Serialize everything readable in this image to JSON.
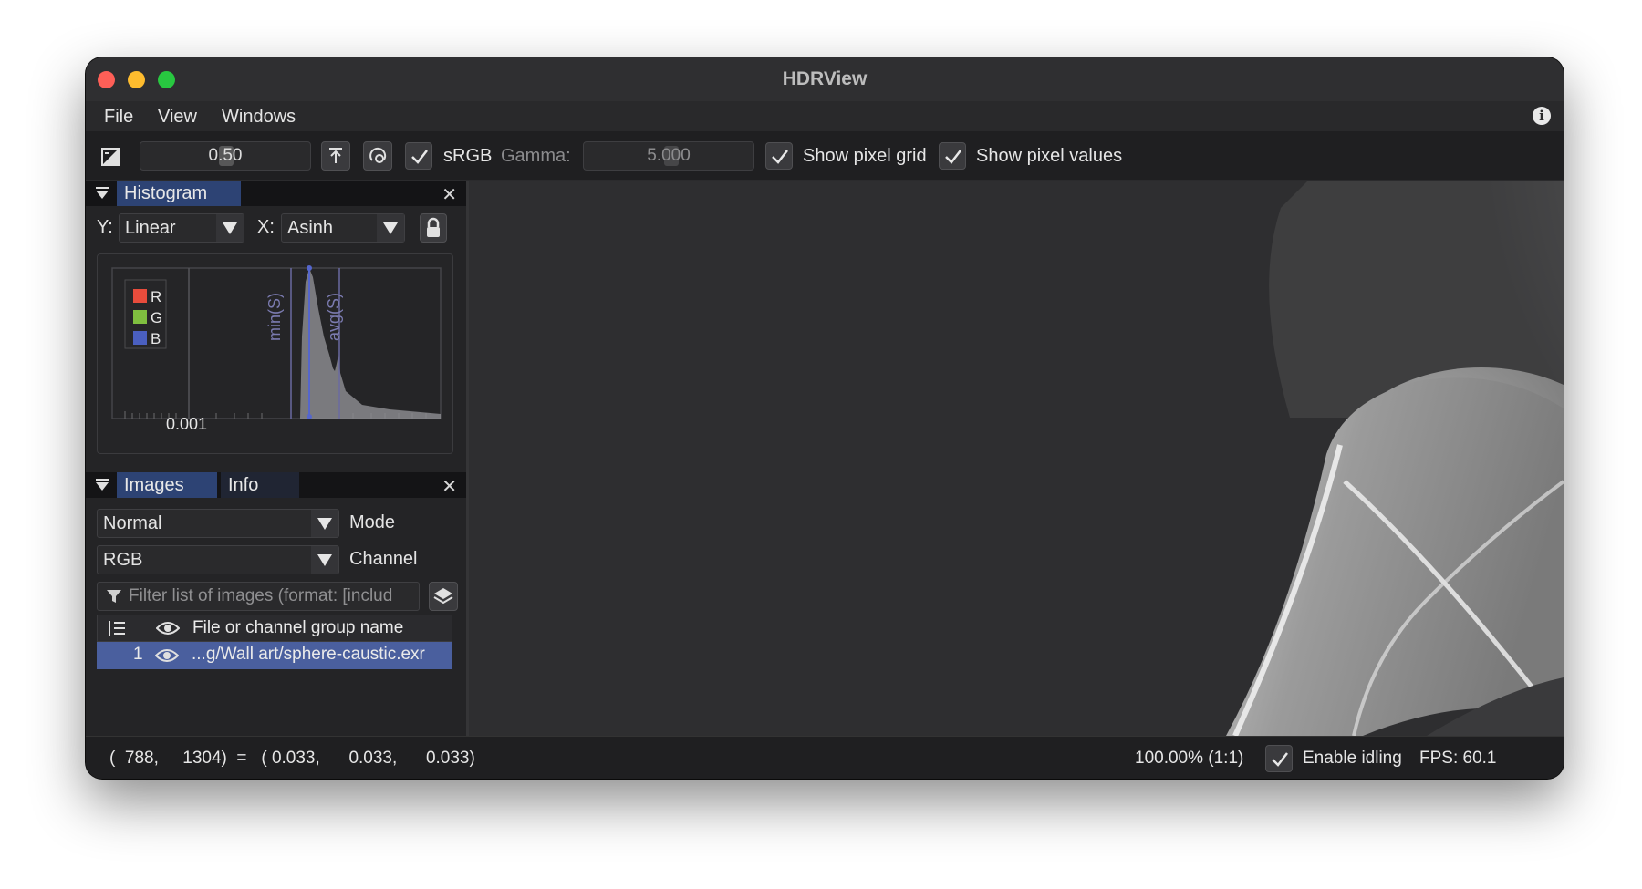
{
  "window": {
    "title": "HDRView"
  },
  "menu": {
    "items": [
      "File",
      "View",
      "Windows"
    ]
  },
  "toolbar": {
    "exposure_value": "0.50",
    "srgb_label": "sRGB",
    "srgb_checked": true,
    "gamma_label": "Gamma:",
    "gamma_value": "5.000",
    "pixel_grid_label": "Show pixel grid",
    "pixel_values_label": "Show pixel values"
  },
  "histogram_panel": {
    "tab_label": "Histogram",
    "y_label": "Y:",
    "y_scale": "Linear",
    "x_label": "X:",
    "x_scale": "Asinh",
    "legend": [
      {
        "label": "R",
        "color": "#e74c3c"
      },
      {
        "label": "G",
        "color": "#7fbf3f"
      },
      {
        "label": "B",
        "color": "#4a5fbf"
      }
    ],
    "marker_min": "min(S)",
    "marker_avg": "avg(S)",
    "tick_label": "0.001"
  },
  "images_panel": {
    "tab_images": "Images",
    "tab_info": "Info",
    "mode_value": "Normal",
    "mode_label": "Mode",
    "channel_value": "RGB",
    "channel_label": "Channel",
    "filter_placeholder": "Filter list of images (format: [includ",
    "column_header": "File or channel group name",
    "rows": [
      {
        "index": "1",
        "name": "...g/Wall art/sphere-caustic.exr"
      }
    ]
  },
  "status": {
    "coords": "(  788,     1304)  =   ( 0.033,      0.033,      0.033)",
    "zoom": "100.00% (1:1)",
    "idling_label": "Enable idling",
    "fps": "FPS: 60.1"
  },
  "colors": {
    "accent": "#2d4374",
    "selection": "#4a5f9e"
  }
}
